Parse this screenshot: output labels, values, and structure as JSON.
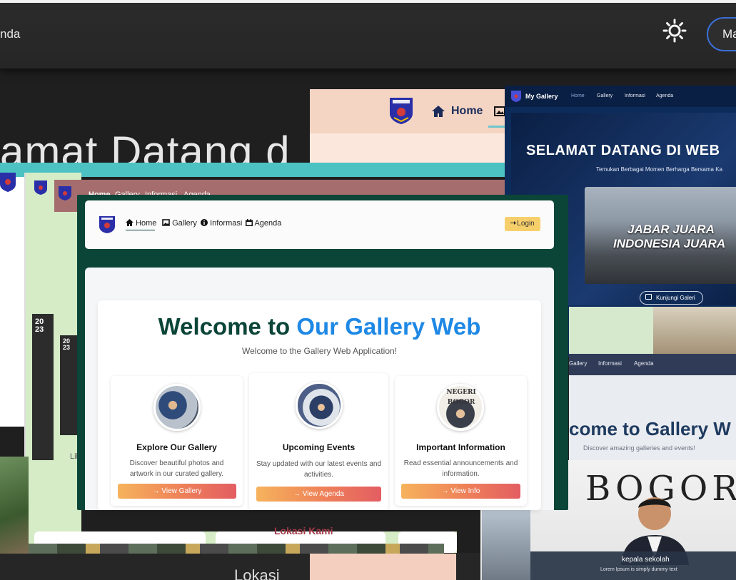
{
  "background_page": {
    "brand": "nda",
    "button_label": "Ma",
    "welcome_partial": "amat Datang d",
    "footer_title": "Lokasi"
  },
  "peach_shot": {
    "nav_home": "Home"
  },
  "mauve_shot": {
    "nav": [
      "Home",
      "Gallery",
      "Informasi",
      "Agenda"
    ]
  },
  "teal_shot": {
    "year_a": "20 23",
    "year_b": "20 23",
    "link_text": "Lil"
  },
  "navy_shot": {
    "brand": "My Gallery",
    "nav": [
      "Home",
      "Gallery",
      "Informasi",
      "Agenda"
    ],
    "title": "SELAMAT DATANG DI WEB",
    "subtitle": "Temukan Berbagai Momen Berharga Bersama Ka",
    "photo_line1": "JABAR JUARA",
    "photo_line2": "INDONESIA JUARA",
    "button_label": "Kunjungi Galeri"
  },
  "gallery_web_shot": {
    "nav": [
      "Gallery",
      "Informasi",
      "Agenda"
    ],
    "title": "come to Gallery W",
    "subtitle": "Discover amazing galleries and events!",
    "photo_text": "BOGOR",
    "caption_title": "kepala sekolah",
    "caption_text": "Lorem Ipsum is simply dummy text"
  },
  "lower_left_shot": {
    "section_title": "Lokasi Kami"
  },
  "main_shot": {
    "nav": {
      "home": "Home",
      "gallery": "Gallery",
      "info": "Informasi",
      "agenda": "Agenda"
    },
    "login_label": "Login",
    "hero_title_prefix": "Welcome to ",
    "hero_title_accent": "Our Gallery Web",
    "hero_subtitle": "Welcome to the Gallery Web Application!",
    "features": [
      {
        "title": "Explore Our Gallery",
        "text": "Discover beautiful photos and artwork in our curated gallery.",
        "button": "→ View Gallery"
      },
      {
        "title": "Upcoming Events",
        "text": "Stay updated with our latest events and activities.",
        "button": "→ View Agenda"
      },
      {
        "title": "Important Information",
        "text": "Read essential announcements and information.",
        "button": "→ View Info",
        "photo_text": "NEGERI BOGOR"
      }
    ]
  },
  "colors": {
    "main_dark_green": "#0b4538",
    "accent_blue": "#1e88e5",
    "login_yellow": "#f7cf6a",
    "button_gradient_start": "#f6b35c",
    "button_gradient_end": "#e35d62",
    "navy": "#0d2c5c",
    "teal_band": "#4cc2c2"
  },
  "icons": [
    "sun-icon",
    "home-icon",
    "image-icon",
    "info-circle-icon",
    "calendar-icon",
    "login-icon"
  ]
}
